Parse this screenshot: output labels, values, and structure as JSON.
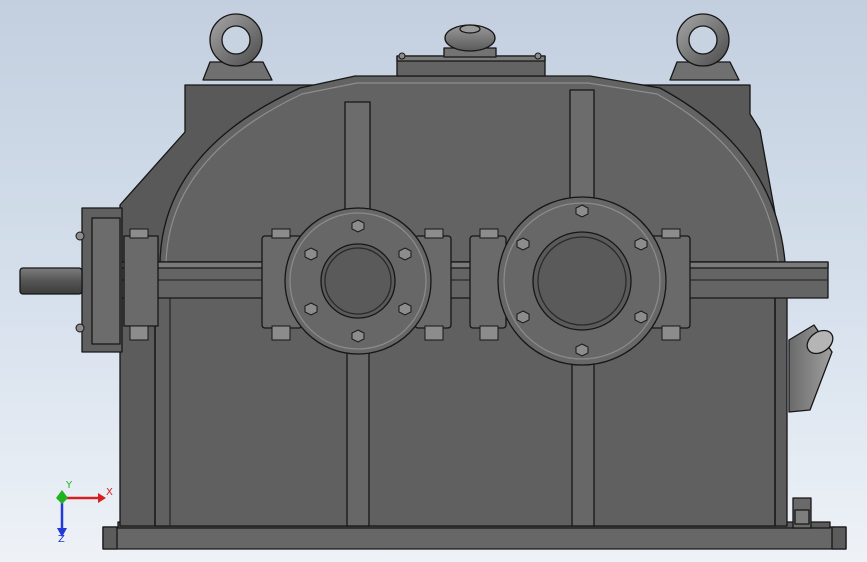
{
  "viewport": {
    "background_top": "#c3cfdf",
    "background_bottom": "#eef2f7"
  },
  "model": {
    "body_color": "#5e5e5e",
    "edge_color": "#161616",
    "highlight_color": "#8e8e8e"
  },
  "triad": {
    "x_label": "X",
    "y_label": "Y",
    "z_label": "Z",
    "x_color": "#d42020",
    "y_color": "#1fb31f",
    "z_color": "#2238d8"
  }
}
